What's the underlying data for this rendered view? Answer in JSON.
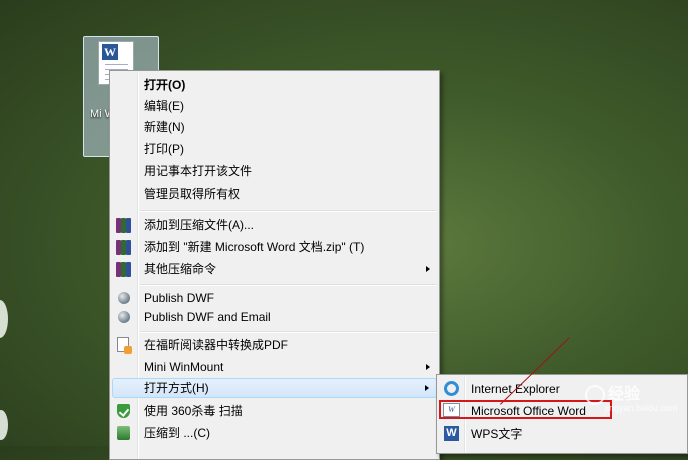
{
  "desktop_icon": {
    "label": "Mi Wo"
  },
  "context_menu": {
    "groups": [
      [
        {
          "label": "打开(O)",
          "bold": true
        },
        {
          "label": "编辑(E)"
        },
        {
          "label": "新建(N)"
        },
        {
          "label": "打印(P)"
        },
        {
          "label": "用记事本打开该文件"
        },
        {
          "label": "管理员取得所有权"
        }
      ],
      [
        {
          "label": "添加到压缩文件(A)...",
          "icon": "winrar-icon"
        },
        {
          "label": "添加到 \"新建 Microsoft Word 文档.zip\" (T)",
          "icon": "winrar-icon"
        },
        {
          "label": "其他压缩命令",
          "icon": "winrar-icon",
          "submenu": true
        }
      ],
      [
        {
          "label": "Publish DWF",
          "icon": "globe-icon"
        },
        {
          "label": "Publish DWF and Email",
          "icon": "globe-icon"
        }
      ],
      [
        {
          "label": "在福昕阅读器中转换成PDF",
          "icon": "pdf-convert-icon"
        },
        {
          "label": "Mini WinMount",
          "submenu": true
        },
        {
          "label": "打开方式(H)",
          "submenu": true,
          "highlighted": true
        },
        {
          "label": "使用 360杀毒 扫描",
          "icon": "shield-icon"
        },
        {
          "label": "压缩到 ...(C)",
          "icon": "compress-icon"
        }
      ]
    ]
  },
  "open_with_submenu": {
    "items": [
      {
        "label": "Internet Explorer",
        "icon": "ie-icon"
      },
      {
        "label": "Microsoft Office Word",
        "icon": "word-icon",
        "selected": true
      },
      {
        "label": "WPS文字",
        "icon": "wps-icon"
      }
    ]
  },
  "watermark": {
    "text": "经验",
    "subtext": "jingyan.baidu.com"
  },
  "colors": {
    "highlight_border": "#a8d8ff",
    "annotation": "#d21818"
  }
}
